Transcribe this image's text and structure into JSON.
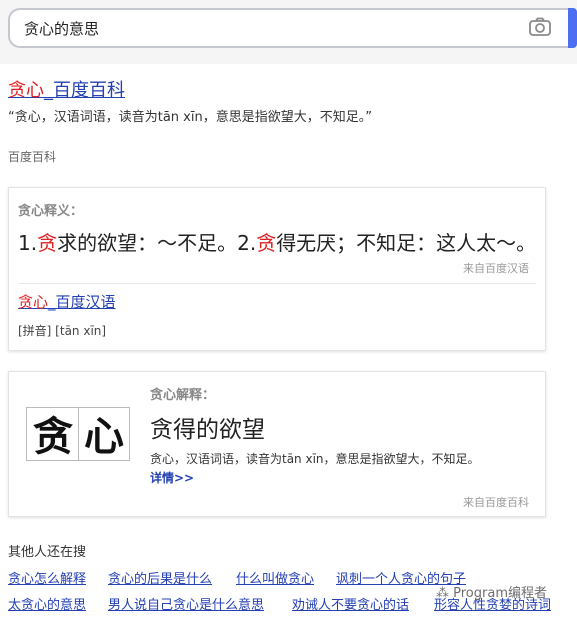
{
  "search": {
    "query": "贪心的意思",
    "camera_icon": "camera-icon",
    "accent_color": "#4e6ef2"
  },
  "result1": {
    "title_highlight": "贪心",
    "title_rest": "_百度百科",
    "description": "“贪心，汉语词语，读音为tān xīn，意思是指欲望大，不知足。”",
    "source": "百度百科"
  },
  "card1": {
    "heading": "贪心释义：",
    "def_part1": "1.",
    "def_hl1": "贪",
    "def_part2": "求的欲望：～不足。2.",
    "def_hl2": "贪",
    "def_part3": "得无厌；不知足：这人太～。",
    "source": "来自百度汉语",
    "link_highlight": "贪心",
    "link_rest": "_百度汉语",
    "pinyin": "[拼音] [tān xīn]"
  },
  "card2": {
    "image_char1": "贪",
    "image_char2": "心",
    "heading": "贪心解释：",
    "title": "贪得的欲望",
    "description": "贪心，汉语词语，读音为tān xīn，意思是指欲望大，不知足。",
    "more": "详情>>",
    "source": "来自百度百科"
  },
  "related": {
    "title": "其他人还在搜",
    "row1": [
      "贪心怎么解释",
      "贪心的后果是什么",
      "什么叫做贪心",
      "讽刺一个人贪心的句子"
    ],
    "row2": [
      "太贪心的意思",
      "男人说自己贪心是什么意思",
      "劝诫人不要贪心的话",
      "形容人性贪婪的诗词"
    ]
  },
  "watermark": "Program编程者",
  "colors": {
    "link": "#2440b3",
    "highlight": "#e02020"
  }
}
